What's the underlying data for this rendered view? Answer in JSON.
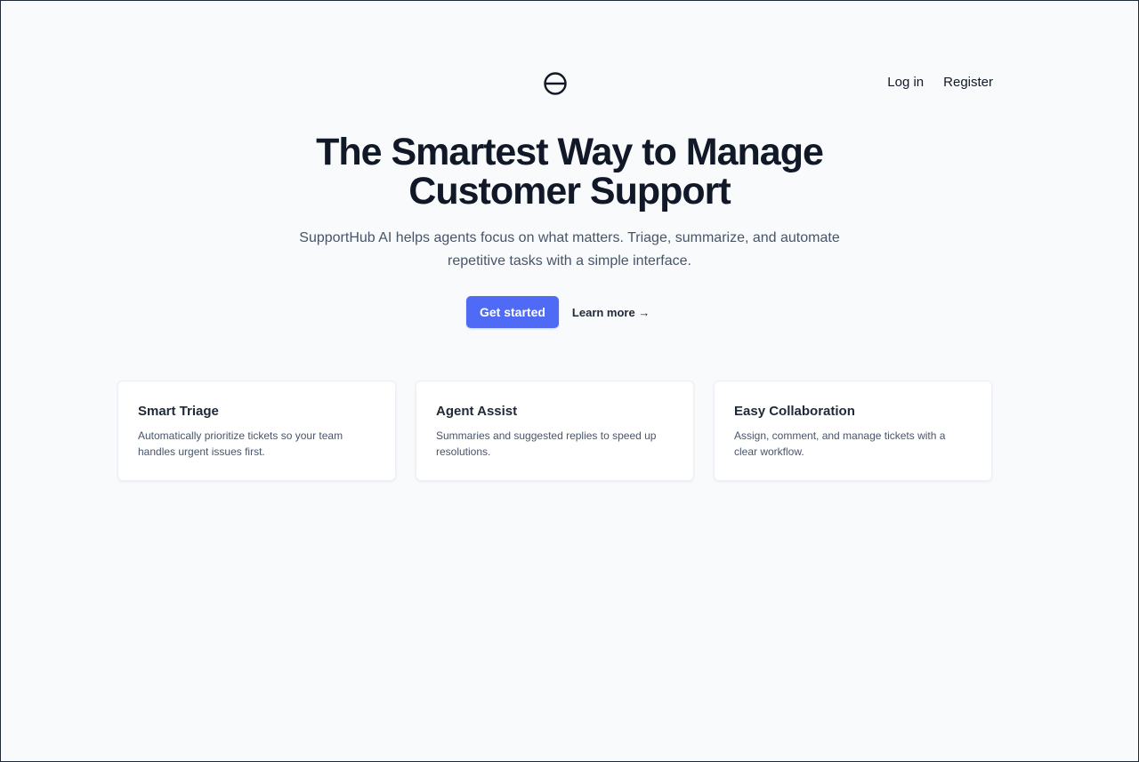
{
  "header": {
    "logo_icon": "circle-slash-logo",
    "nav": {
      "login": "Log in",
      "register": "Register"
    }
  },
  "hero": {
    "title": "The Smartest Way to Manage Customer Support",
    "subtitle": "SupportHub AI helps agents focus on what matters. Triage, summarize, and automate repetitive tasks with a simple interface.",
    "cta_primary": "Get started",
    "cta_secondary": "Learn more →"
  },
  "features": [
    {
      "title": "Smart Triage",
      "description": "Automatically prioritize tickets so your team handles urgent issues first."
    },
    {
      "title": "Agent Assist",
      "description": "Summaries and suggested replies to speed up resolutions."
    },
    {
      "title": "Easy Collaboration",
      "description": "Assign, comment, and manage tickets with a clear workflow."
    }
  ],
  "colors": {
    "background": "#f8fafc",
    "primary": "#4f6bf6",
    "text": "#111827",
    "muted": "#475569"
  }
}
